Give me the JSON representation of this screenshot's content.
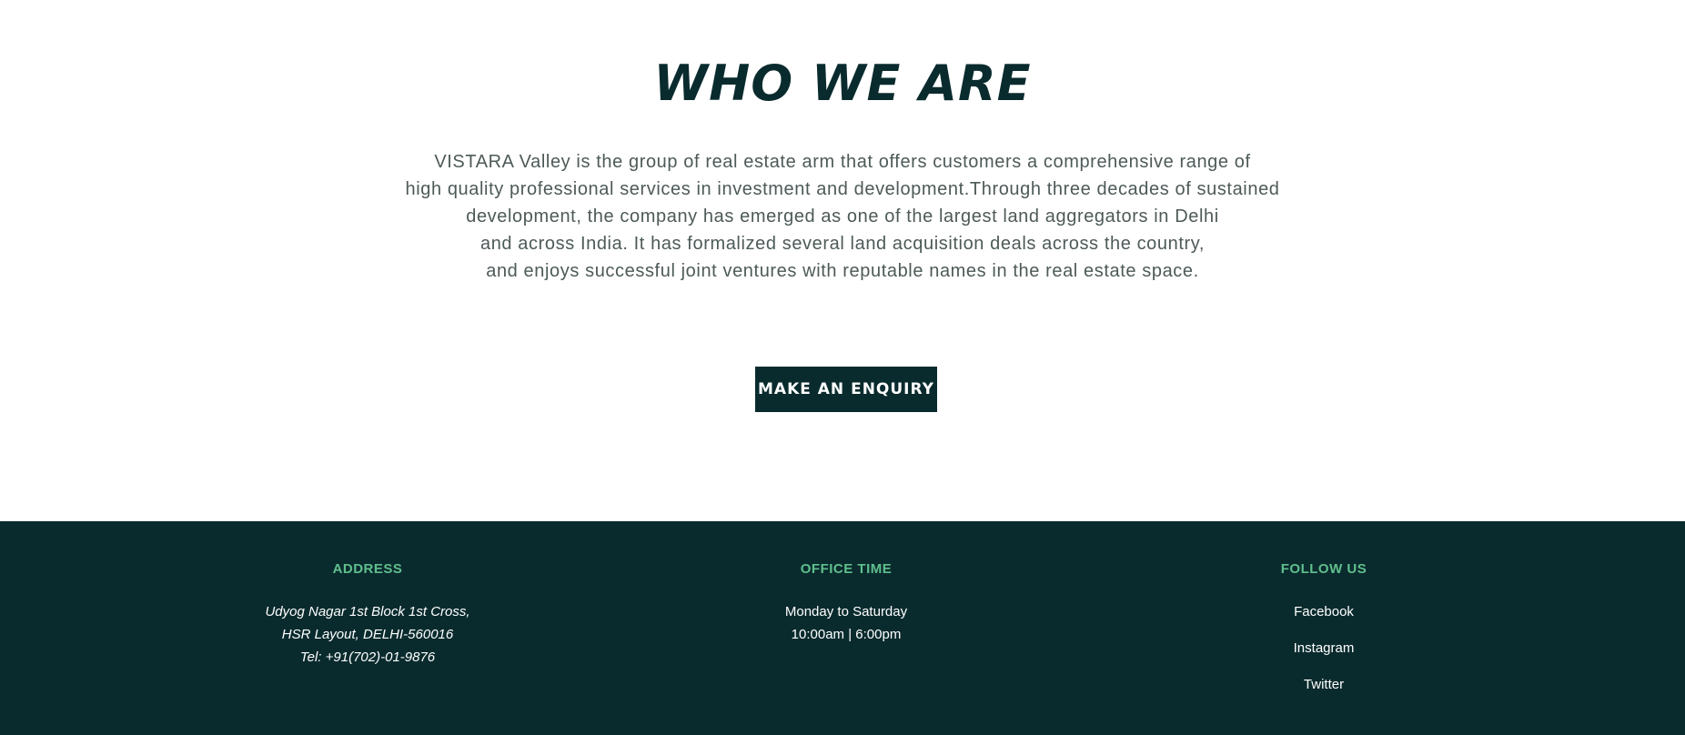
{
  "about": {
    "title": "WHO WE ARE",
    "lines": [
      "VISTARA Valley is the group of real estate arm that offers customers a comprehensive range of",
      "high quality professional services in investment and development.Through three decades of sustained",
      "development, the company has emerged as one of the largest land aggregators in Delhi",
      "and across India. It has formalized several land acquisition deals across the country,",
      "and enjoys successful joint ventures with reputable names in the real estate space."
    ],
    "button_label": "MAKE AN ENQUIRY"
  },
  "footer": {
    "address": {
      "heading": "ADDRESS",
      "lines": [
        "Udyog Nagar 1st Block 1st Cross,",
        "HSR Layout, DELHI-560016",
        "Tel: +91(702)-01-9876"
      ]
    },
    "office_time": {
      "heading": "OFFICE TIME",
      "lines": [
        "Monday to Saturday",
        "10:00am | 6:00pm"
      ]
    },
    "follow_us": {
      "heading": "FOLLOW US",
      "links": [
        "Facebook",
        "Instagram",
        "Twitter"
      ]
    }
  },
  "colors": {
    "primary_dark": "#0a2b2e",
    "accent_green": "#5fbf8d",
    "body_text": "#4d5a58",
    "white": "#ffffff"
  }
}
